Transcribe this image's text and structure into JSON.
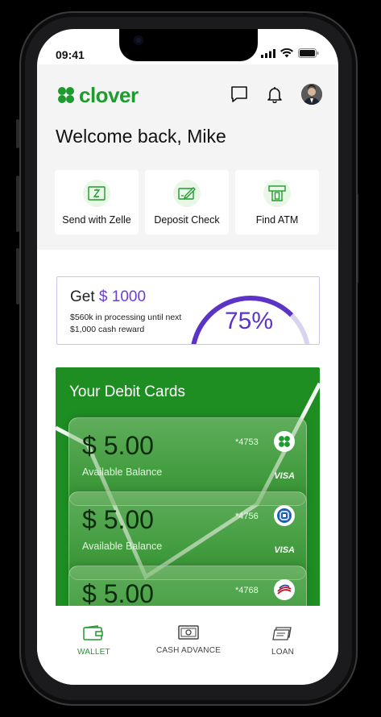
{
  "status": {
    "time": "09:41"
  },
  "app": {
    "name": "clover"
  },
  "header": {
    "welcome": "Welcome back, Mike"
  },
  "quick_actions": [
    {
      "label": "Send with Zelle",
      "icon": "zelle-icon"
    },
    {
      "label": "Deposit Check",
      "icon": "check-icon"
    },
    {
      "label": "Find ATM",
      "icon": "atm-icon"
    }
  ],
  "promo": {
    "prefix": "Get",
    "amount": "$ 1000",
    "subtitle": "$560k in processing until next $1,000 cash reward",
    "percent_label": "75%",
    "progress": 0.75
  },
  "debit": {
    "title": "Your Debit Cards",
    "cards": [
      {
        "balance": "$ 5.00",
        "label": "Available Balance",
        "number": "*4753",
        "brand": "VISA",
        "bank_icon": "clover-bank-icon"
      },
      {
        "balance": "$ 5.00",
        "label": "Available Balance",
        "number": "*4756",
        "brand": "VISA",
        "bank_icon": "chase-bank-icon"
      },
      {
        "balance": "$ 5.00",
        "label": "",
        "number": "*4768",
        "brand": "",
        "bank_icon": "bofa-bank-icon"
      }
    ]
  },
  "nav": {
    "items": [
      {
        "label": "WALLET",
        "icon": "wallet-icon",
        "active": true
      },
      {
        "label": "CASH ADVANCE",
        "icon": "cash-icon",
        "active": false
      },
      {
        "label": "LOAN",
        "icon": "loan-icon",
        "active": false
      }
    ]
  },
  "colors": {
    "brand": "#1f9a2e",
    "accent": "#5b33c7",
    "card_bg": "#1e8e23"
  }
}
